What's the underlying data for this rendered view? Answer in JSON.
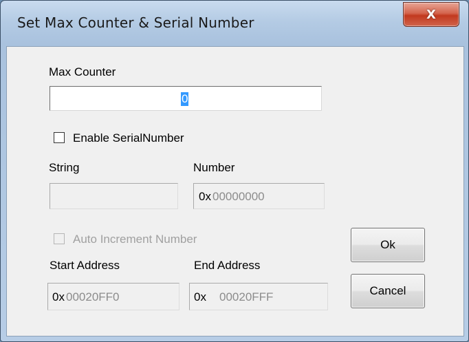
{
  "window": {
    "title": "Set Max Counter & Serial Number",
    "close_glyph": "X"
  },
  "max_counter": {
    "label": "Max Counter",
    "value": "0"
  },
  "serial": {
    "enable_label": "Enable SerialNumber",
    "enabled": false
  },
  "string_field": {
    "label": "String",
    "value": ""
  },
  "number_field": {
    "label": "Number",
    "prefix": "0x",
    "value": "00000000"
  },
  "auto_increment": {
    "label": "Auto Increment Number",
    "checked": false
  },
  "start_address": {
    "label": "Start Address",
    "prefix": "0x",
    "value": "00020FF0"
  },
  "end_address": {
    "label": "End Address",
    "prefix": "0x",
    "value": "00020FFF"
  },
  "buttons": {
    "ok": "Ok",
    "cancel": "Cancel"
  },
  "colors": {
    "selection": "#3399ff",
    "client_bg": "#f0f0f0",
    "close_red": "#c2391f"
  }
}
